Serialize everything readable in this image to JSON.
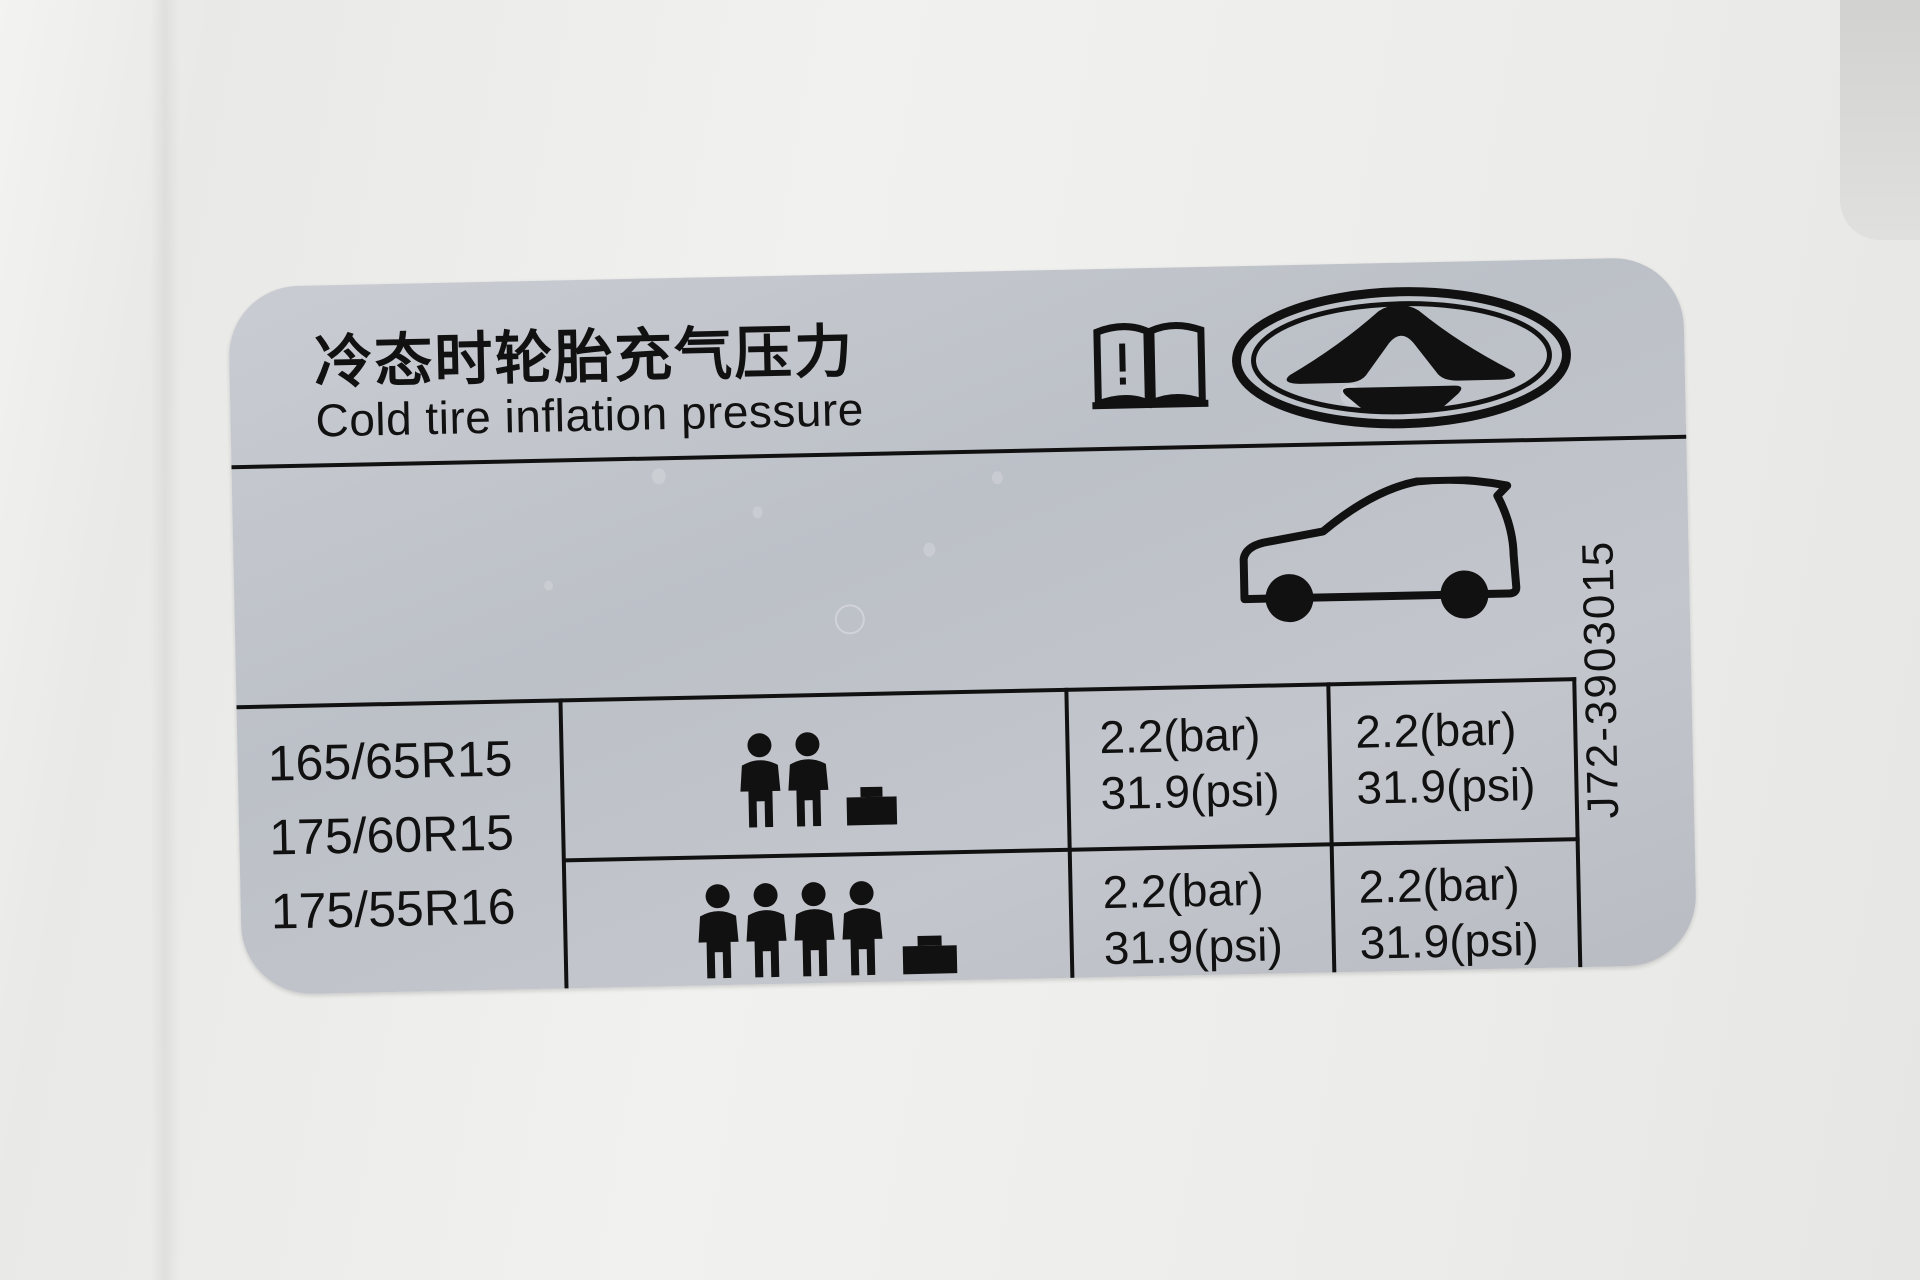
{
  "label": {
    "title_zh": "冷态时轮胎充气压力",
    "title_en": "Cold tire inflation pressure",
    "tire_sizes": [
      "165/65R15",
      "175/60R15",
      "175/55R16"
    ],
    "loads": [
      {
        "occupants": 2,
        "front": {
          "bar": "2.2(bar)",
          "psi": "31.9(psi)"
        },
        "rear": {
          "bar": "2.2(bar)",
          "psi": "31.9(psi)"
        }
      },
      {
        "occupants": 4,
        "front": {
          "bar": "2.2(bar)",
          "psi": "31.9(psi)"
        },
        "rear": {
          "bar": "2.2(bar)",
          "psi": "31.9(psi)"
        }
      }
    ],
    "part_number": "J72-3903015",
    "icons": [
      "book-warning-icon",
      "brand-logo",
      "car-side-icon",
      "occupants-luggage-icon"
    ]
  },
  "colors": {
    "label_silver": "#c3c6cc",
    "ink": "#111111",
    "background": "#efefed"
  }
}
